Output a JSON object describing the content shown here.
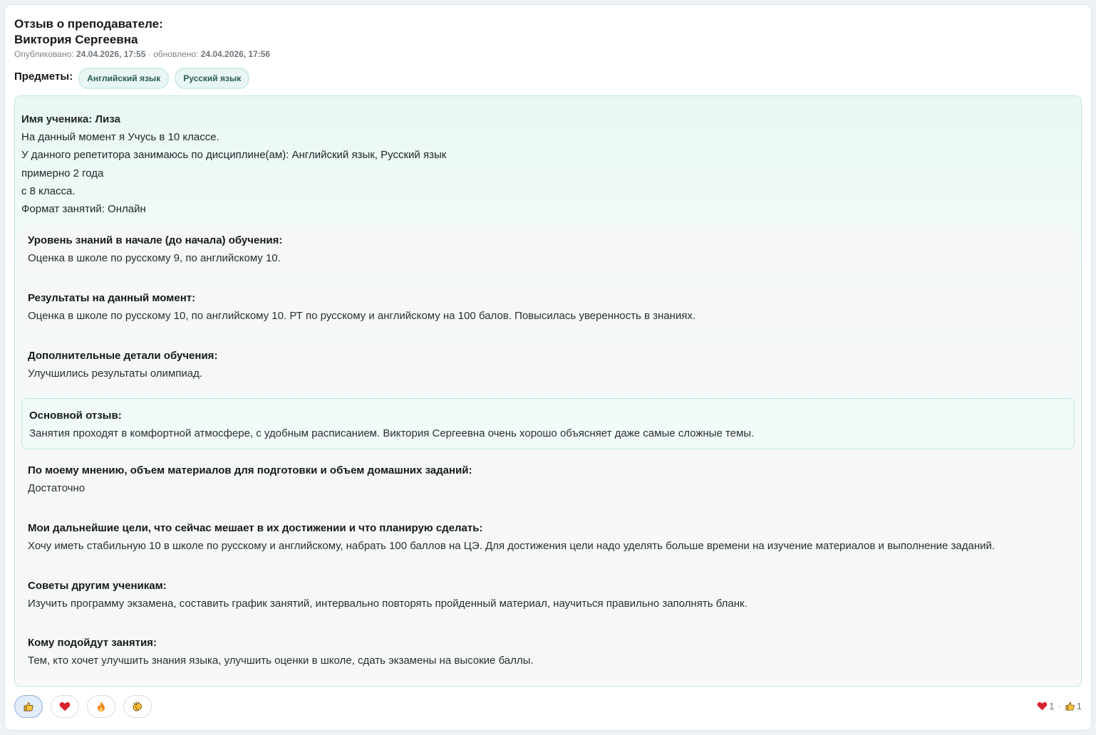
{
  "header": {
    "title_line1": "Отзыв о преподавателе:",
    "title_line2": "Виктория Сергеевна",
    "published_label": "Опубликовано:",
    "published_date": "24.04.2026, 17:55",
    "separator": "·",
    "updated_label": "обновлено:",
    "updated_date": "24.04.2026, 17:56"
  },
  "subjects": {
    "label": "Предметы:",
    "items": [
      "Английский язык",
      "Русский язык"
    ]
  },
  "review": {
    "student_name": "Имя ученика: Лиза",
    "lines": [
      "На данный момент я Учусь в 10 классе.",
      "У данного репетитора занимаюсь по дисциплине(ам): Английский язык, Русский язык",
      "примерно 2 года",
      "с 8 класса.",
      "Формат занятий: Онлайн"
    ],
    "sections": [
      {
        "title": "Уровень знаний в начале (до начала) обучения:",
        "text": "Оценка в школе по русскому 9, по английскому 10."
      },
      {
        "title": "Результаты на данный момент:",
        "text": "Оценка в школе по русскому 10, по английскому 10. РТ по русскому и английскому на 100 балов. Повысилась уверенность в знаниях."
      },
      {
        "title": "Дополнительные детали обучения:",
        "text": "Улучшились результаты олимпиад."
      },
      {
        "title": "Основной отзыв:",
        "text": "Занятия проходят в комфортной атмосфере, с удобным расписанием. Виктория Сергеевна очень хорошо объясняет даже самые сложные темы."
      },
      {
        "title": "По моему мнению, объем материалов для подготовки и объем домашних заданий:",
        "text": "Достаточно"
      },
      {
        "title": "Мои дальнейшие цели, что сейчас мешает в их достижении и что планирую сделать:",
        "text": "Хочу иметь стабильную 10 в школе по русскому и английскому, набрать 100 баллов на ЦЭ. Для достижения цели надо уделять больше времени на изучение материалов и выполнение заданий."
      },
      {
        "title": "Советы другим ученикам:",
        "text": "Изучить программу экзамена, составить график занятий, интервально повторять пройденный материал, научиться правильно заполнять бланк."
      },
      {
        "title": "Кому подойдут занятия:",
        "text": "Тем, кто хочет улучшить знания языка, улучшить оценки в школе, сдать экзамены на высокие баллы."
      }
    ]
  },
  "reactions": {
    "buttons": [
      {
        "icon": "thumbs-up-icon",
        "active": true
      },
      {
        "icon": "heart-icon",
        "active": false
      },
      {
        "icon": "fire-icon",
        "active": false
      },
      {
        "icon": "clapping-hands-icon",
        "active": false
      }
    ],
    "counts": {
      "heart": "1",
      "separator": "·",
      "thumbs_up": "1"
    }
  },
  "colors": {
    "accent": "#bfe6e0",
    "chip_bg": "#e8f7f4",
    "active_reaction_bg": "#e3ecf9",
    "heart": "#d8232f"
  }
}
